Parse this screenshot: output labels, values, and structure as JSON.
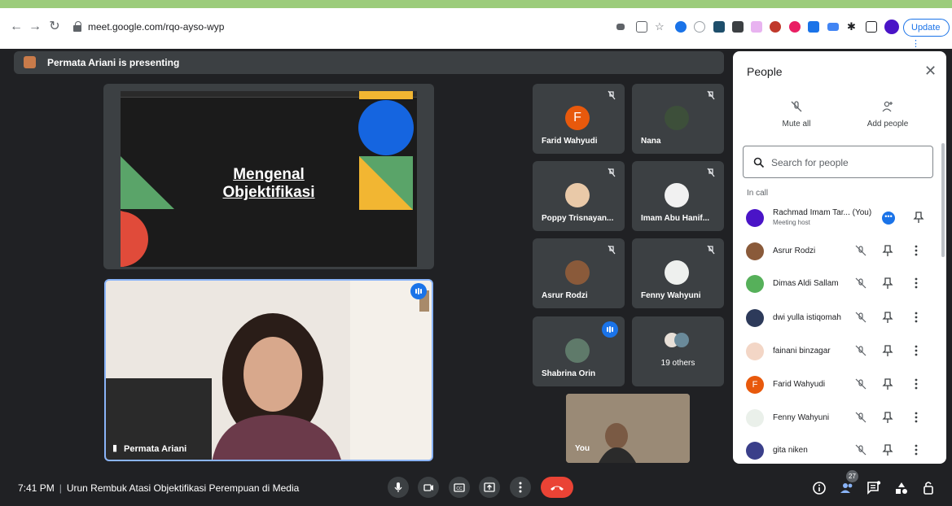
{
  "browser": {
    "url": "meet.google.com/rqo-ayso-wyp",
    "update_label": "Update"
  },
  "presenting_bar": {
    "text": "Permata Ariani is presenting"
  },
  "slide": {
    "title_line1": "Mengenal",
    "title_line2": "Objektifikasi"
  },
  "presenter": {
    "name": "Permata Ariani"
  },
  "tiles": [
    {
      "name": "Farid Wahyudi",
      "initial": "F"
    },
    {
      "name": "Nana"
    },
    {
      "name": "Poppy Trisnayan..."
    },
    {
      "name": "Imam Abu Hanif..."
    },
    {
      "name": "Asrur Rodzi"
    },
    {
      "name": "Fenny Wahyuni"
    },
    {
      "name": "Shabrina Orin"
    },
    {
      "name": "19 others"
    }
  ],
  "self_tile": {
    "label": "You"
  },
  "bottom": {
    "time": "7:41 PM",
    "meeting_title": "Urun Rembuk Atasi Objektifikasi Perempuan di Media",
    "people_count": "27"
  },
  "people_panel": {
    "title": "People",
    "mute_all_label": "Mute all",
    "add_people_label": "Add people",
    "search_placeholder": "Search for people",
    "section_label": "In call",
    "host": {
      "name": "Rachmad Imam Tar...",
      "you": "(You)",
      "role": "Meeting host"
    },
    "participants": [
      {
        "name": "Asrur Rodzi"
      },
      {
        "name": "Dimas Aldi Sallam"
      },
      {
        "name": "dwi yulla istiqomah"
      },
      {
        "name": "fainani binzagar"
      },
      {
        "name": "Farid Wahyudi",
        "initial": "F"
      },
      {
        "name": "Fenny Wahyuni"
      },
      {
        "name": "gita niken"
      }
    ]
  },
  "colors": {
    "accent": "#1a73e8",
    "end_call": "#ea4335",
    "background": "#202124"
  }
}
